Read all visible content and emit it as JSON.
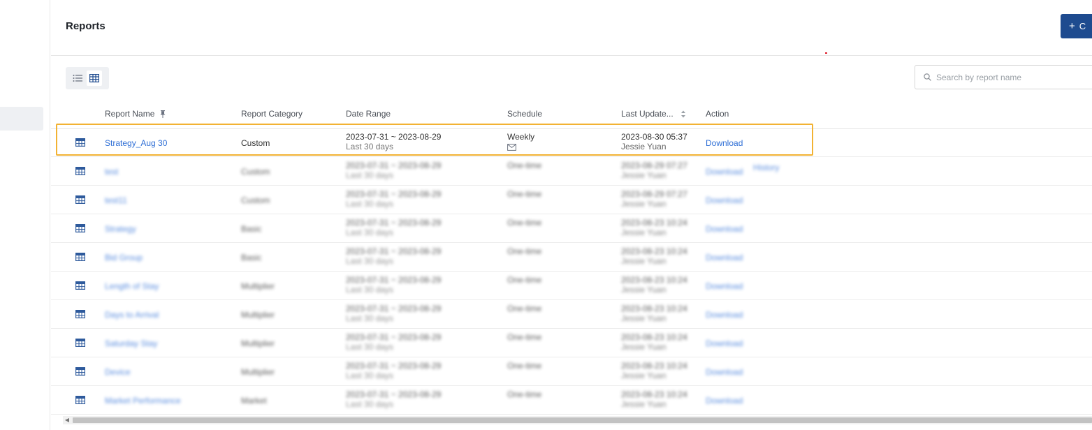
{
  "page": {
    "title": "Reports"
  },
  "header": {
    "create_label": "C",
    "create_icon": "plus-icon"
  },
  "colors": {
    "accent": "#1e4b8f",
    "link": "#2f6fd6",
    "highlight": "#f2b233"
  },
  "view_toggle": {
    "options": [
      "list-view",
      "table-view"
    ],
    "selected": "table-view"
  },
  "search": {
    "placeholder": "Search by report name",
    "value": ""
  },
  "table": {
    "columns": [
      "Report Name",
      "Report Category",
      "Date Range",
      "Schedule",
      "Last Update...",
      "Action"
    ],
    "rows": [
      {
        "name": "Strategy_Aug 30",
        "category": "Custom",
        "date_range": "2023-07-31 ~ 2023-08-29",
        "range_label": "Last 30 days",
        "schedule": "Weekly",
        "schedule_icon": "email-schedule-icon",
        "updated": "2023-08-30 05:37",
        "updated_by": "Jessie Yuan",
        "action": "Download",
        "action2": ""
      },
      {
        "name": "test",
        "category": "Custom",
        "date_range": "2023-07-31 ~ 2023-08-29",
        "range_label": "Last 30 days",
        "schedule": "One-time",
        "updated": "2023-08-29 07:27",
        "updated_by": "Jessie Yuan",
        "action": "Download",
        "action2": "History"
      },
      {
        "name": "test11",
        "category": "Custom",
        "date_range": "2023-07-31 ~ 2023-08-29",
        "range_label": "Last 30 days",
        "schedule": "One-time",
        "updated": "2023-08-29 07:27",
        "updated_by": "Jessie Yuan",
        "action": "Download",
        "action2": ""
      },
      {
        "name": "Strategy",
        "category": "Basic",
        "date_range": "2023-07-31 ~ 2023-08-29",
        "range_label": "Last 30 days",
        "schedule": "One-time",
        "updated": "2023-08-23 10:24",
        "updated_by": "Jessie Yuan",
        "action": "Download",
        "action2": ""
      },
      {
        "name": "Bid Group",
        "category": "Basic",
        "date_range": "2023-07-31 ~ 2023-08-29",
        "range_label": "Last 30 days",
        "schedule": "One-time",
        "updated": "2023-08-23 10:24",
        "updated_by": "Jessie Yuan",
        "action": "Download",
        "action2": ""
      },
      {
        "name": "Length of Stay",
        "category": "Multiplier",
        "date_range": "2023-07-31 ~ 2023-08-29",
        "range_label": "Last 30 days",
        "schedule": "One-time",
        "updated": "2023-08-23 10:24",
        "updated_by": "Jessie Yuan",
        "action": "Download",
        "action2": ""
      },
      {
        "name": "Days to Arrival",
        "category": "Multiplier",
        "date_range": "2023-07-31 ~ 2023-08-29",
        "range_label": "Last 30 days",
        "schedule": "One-time",
        "updated": "2023-08-23 10:24",
        "updated_by": "Jessie Yuan",
        "action": "Download",
        "action2": ""
      },
      {
        "name": "Saturday Stay",
        "category": "Multiplier",
        "date_range": "2023-07-31 ~ 2023-08-29",
        "range_label": "Last 30 days",
        "schedule": "One-time",
        "updated": "2023-08-23 10:24",
        "updated_by": "Jessie Yuan",
        "action": "Download",
        "action2": ""
      },
      {
        "name": "Device",
        "category": "Multiplier",
        "date_range": "2023-07-31 ~ 2023-08-29",
        "range_label": "Last 30 days",
        "schedule": "One-time",
        "updated": "2023-08-23 10:24",
        "updated_by": "Jessie Yuan",
        "action": "Download",
        "action2": ""
      },
      {
        "name": "Market Performance",
        "category": "Market",
        "date_range": "2023-07-31 ~ 2023-08-29",
        "range_label": "Last 30 days",
        "schedule": "One-time",
        "updated": "2023-08-23 10:24",
        "updated_by": "Jessie Yuan",
        "action": "Download",
        "action2": ""
      }
    ]
  }
}
